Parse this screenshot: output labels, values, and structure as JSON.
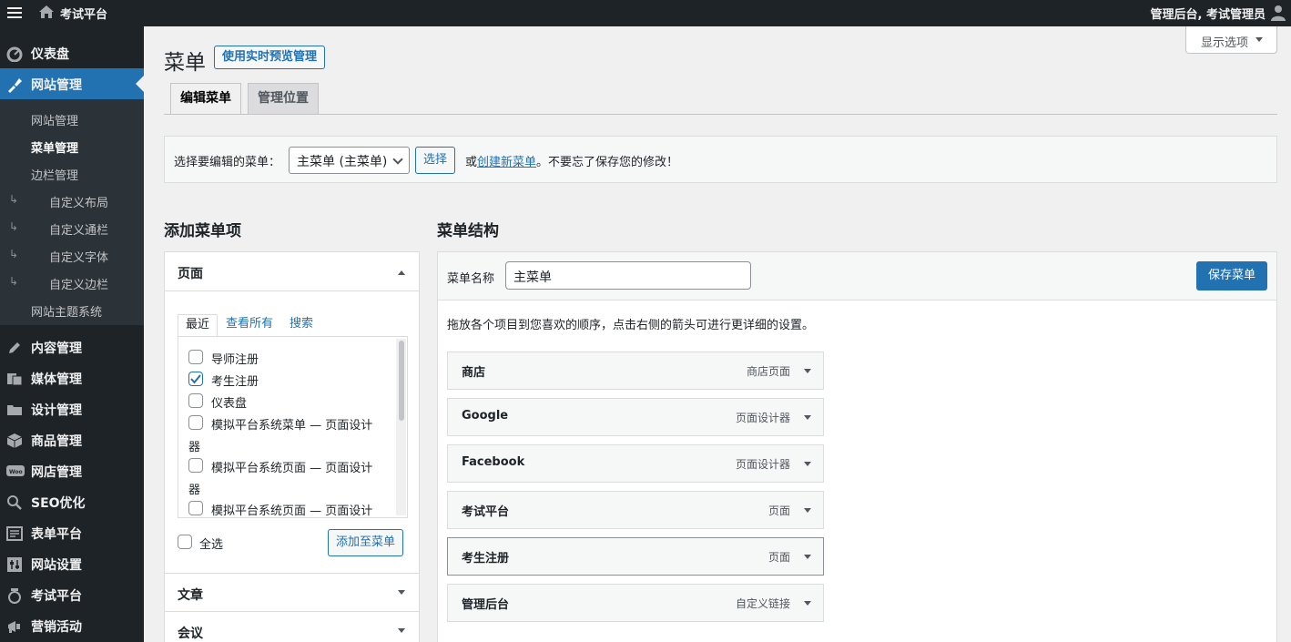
{
  "topbar": {
    "site_name": "考试平台",
    "user_text": "管理后台, 考试管理员"
  },
  "sidebar": {
    "items": [
      {
        "label": "仪表盘",
        "icon": "dashboard-icon"
      },
      {
        "label": "网站管理",
        "icon": "appearance-icon",
        "active": true
      },
      {
        "label": "内容管理",
        "icon": "pencil-icon"
      },
      {
        "label": "媒体管理",
        "icon": "media-icon"
      },
      {
        "label": "设计管理",
        "icon": "folder-icon"
      },
      {
        "label": "商品管理",
        "icon": "box-icon"
      },
      {
        "label": "网店管理",
        "icon": "woo-icon"
      },
      {
        "label": "SEO优化",
        "icon": "search-icon"
      },
      {
        "label": "表单平台",
        "icon": "form-icon"
      },
      {
        "label": "网站设置",
        "icon": "settings-icon"
      },
      {
        "label": "考试平台",
        "icon": "exam-icon"
      },
      {
        "label": "营销活动",
        "icon": "megaphone-icon"
      }
    ],
    "submenu": [
      {
        "label": "网站管理"
      },
      {
        "label": "菜单管理",
        "current": true
      },
      {
        "label": "边栏管理"
      },
      {
        "label": "自定义布局",
        "child": true
      },
      {
        "label": "自定义通栏",
        "child": true
      },
      {
        "label": "自定义字体",
        "child": true
      },
      {
        "label": "自定义边栏",
        "child": true
      },
      {
        "label": "网站主题系统"
      }
    ]
  },
  "main": {
    "title": "菜单",
    "live_preview_button": "使用实时预览管理",
    "screen_options": "显示选项",
    "tabs": [
      "编辑菜单",
      "管理位置"
    ],
    "select_label": "选择要编辑的菜单：",
    "select_value": "主菜单 (主菜单)",
    "select_button": "选择",
    "or_text": "或",
    "create_link": "创建新菜单",
    "save_reminder": "。不要忘了保存您的修改！"
  },
  "add_items": {
    "title": "添加菜单项",
    "pages_heading": "页面",
    "inner_tabs": [
      "最近",
      "查看所有",
      "搜索"
    ],
    "pages": [
      {
        "label": "导师注册",
        "checked": false
      },
      {
        "label": "考生注册",
        "checked": true
      },
      {
        "label": "仪表盘",
        "checked": false
      },
      {
        "label": "模拟平台系统菜单 — 页面设计",
        "label2": "器",
        "checked": false
      },
      {
        "label": "模拟平台系统页面 — 页面设计",
        "label2": "器",
        "checked": false
      },
      {
        "label": "模拟平台系统页面 — 页面设计",
        "checked": false
      }
    ],
    "select_all": "全选",
    "add_button": "添加至菜单",
    "posts_heading": "文章",
    "events_heading": "会议"
  },
  "structure": {
    "title": "菜单结构",
    "name_label": "菜单名称",
    "name_value": "主菜单",
    "save_button": "保存菜单",
    "hint": "拖放各个项目到您喜欢的顺序，点击右侧的箭头可进行更详细的设置。",
    "items": [
      {
        "title": "商店",
        "type": "商店页面"
      },
      {
        "title": "Google",
        "type": "页面设计器"
      },
      {
        "title": "Facebook",
        "type": "页面设计器"
      },
      {
        "title": "考试平台",
        "type": "页面"
      },
      {
        "title": "考生注册",
        "type": "页面"
      },
      {
        "title": "管理后台",
        "type": "自定义链接"
      }
    ]
  },
  "colors": {
    "accent": "#2271b1",
    "sidebar_bg": "#1d2327",
    "submenu_bg": "#2c3338"
  }
}
